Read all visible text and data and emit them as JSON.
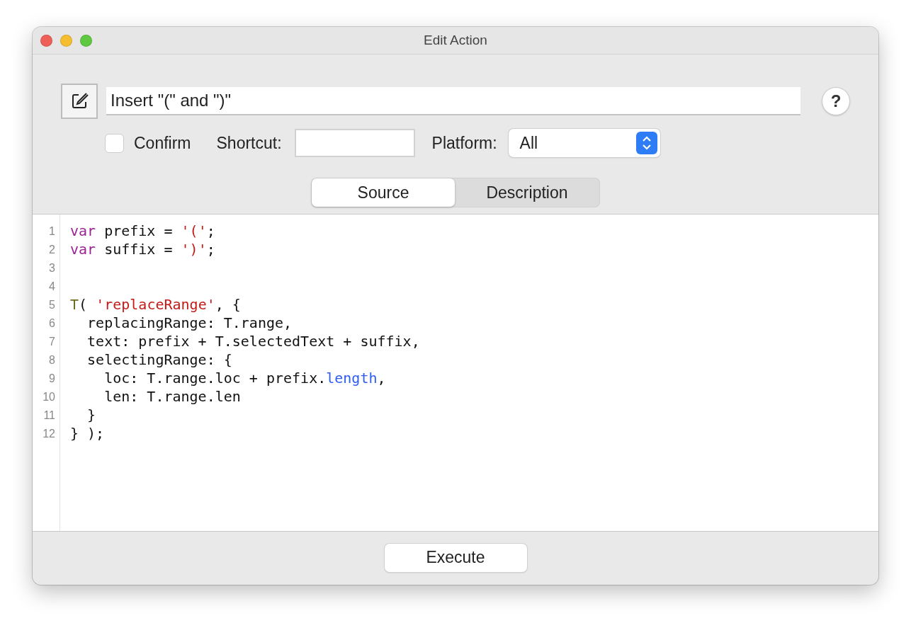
{
  "window": {
    "title": "Edit Action"
  },
  "action": {
    "name": "Insert \"(\" and \")\"",
    "help": "?"
  },
  "options": {
    "confirm": {
      "label": "Confirm",
      "checked": false
    },
    "shortcut": {
      "label": "Shortcut:"
    },
    "platform": {
      "label": "Platform:",
      "value": "All"
    }
  },
  "tabs": [
    {
      "label": "Source",
      "selected": true
    },
    {
      "label": "Description",
      "selected": false
    }
  ],
  "editor": {
    "lines": [
      {
        "number": "1",
        "tokens": [
          {
            "kind": "keyword",
            "text": "var"
          },
          {
            "kind": "plain",
            "text": " prefix = "
          },
          {
            "kind": "string",
            "text": "'('"
          },
          {
            "kind": "plain",
            "text": ";"
          }
        ]
      },
      {
        "number": "2",
        "tokens": [
          {
            "kind": "keyword",
            "text": "var"
          },
          {
            "kind": "plain",
            "text": " suffix = "
          },
          {
            "kind": "string",
            "text": "')'"
          },
          {
            "kind": "plain",
            "text": ";"
          }
        ]
      },
      {
        "number": "3"
      },
      {
        "number": "4"
      },
      {
        "number": "5",
        "tokens": [
          {
            "kind": "function",
            "text": "T"
          },
          {
            "kind": "plain",
            "text": "( "
          },
          {
            "kind": "string",
            "text": "'replaceRange'"
          },
          {
            "kind": "plain",
            "text": ", {"
          }
        ]
      },
      {
        "number": "6",
        "tokens": [
          {
            "kind": "plain",
            "text": "  replacingRange: T.range,"
          }
        ]
      },
      {
        "number": "7",
        "tokens": [
          {
            "kind": "plain",
            "text": "  text: prefix + T.selectedText + suffix,"
          }
        ]
      },
      {
        "number": "8",
        "tokens": [
          {
            "kind": "plain",
            "text": "  selectingRange: {"
          }
        ]
      },
      {
        "number": "9",
        "tokens": [
          {
            "kind": "plain",
            "text": "    loc: T.range.loc + prefix."
          },
          {
            "kind": "property",
            "text": "length"
          },
          {
            "kind": "plain",
            "text": ","
          }
        ]
      },
      {
        "number": "10",
        "tokens": [
          {
            "kind": "plain",
            "text": "    len: T.range.len"
          }
        ]
      },
      {
        "number": "11",
        "tokens": [
          {
            "kind": "plain",
            "text": "  }"
          }
        ]
      },
      {
        "number": "12",
        "tokens": [
          {
            "kind": "plain",
            "text": "} );"
          }
        ]
      }
    ]
  },
  "footer": {
    "button": "Execute"
  }
}
